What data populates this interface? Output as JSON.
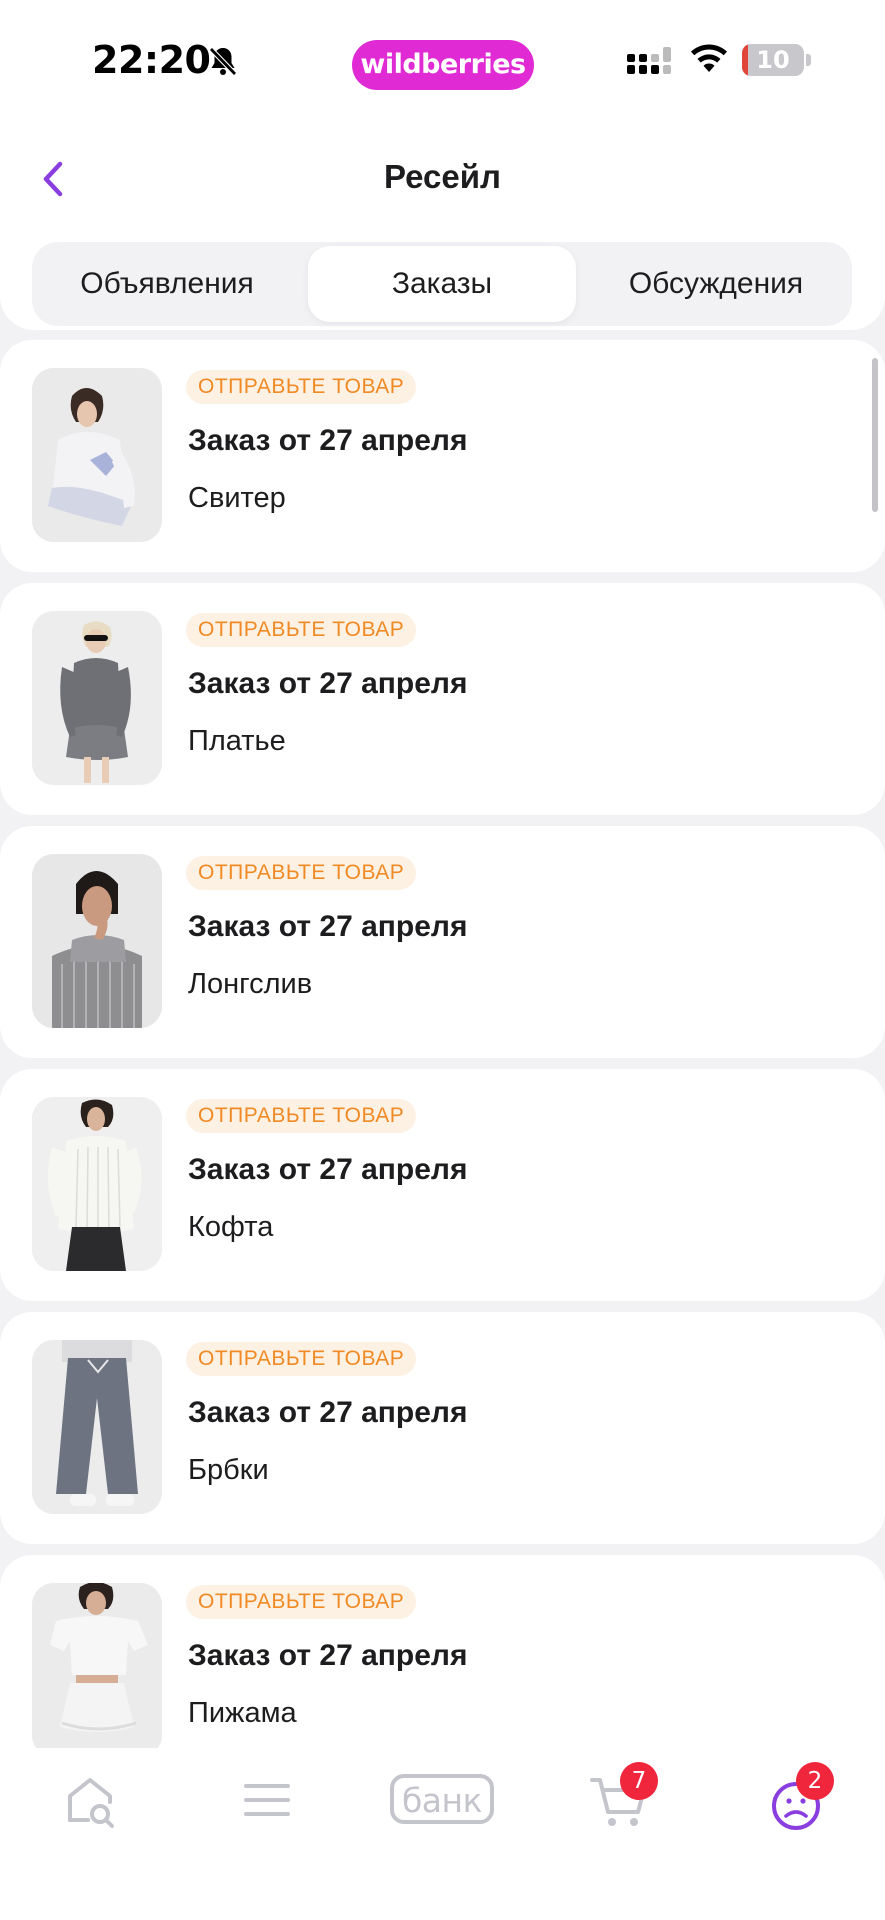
{
  "status_bar": {
    "time": "22:20",
    "brand_pill": "wildberries",
    "battery_level": "10",
    "battery_fraction": 0.1,
    "icons": [
      "bell-slash-icon",
      "cellular-signal-icon",
      "wifi-icon",
      "battery-icon"
    ]
  },
  "header": {
    "title": "Ресейл",
    "back_icon": "chevron-left-icon"
  },
  "tabs": [
    {
      "label": "Объявления",
      "active": false
    },
    {
      "label": "Заказы",
      "active": true
    },
    {
      "label": "Обсуждения",
      "active": false
    }
  ],
  "orders": [
    {
      "status": "ОТПРАВЬТЕ ТОВАР",
      "title": "Заказ от 27 апреля",
      "item": "Свитер"
    },
    {
      "status": "ОТПРАВЬТЕ ТОВАР",
      "title": "Заказ от 27 апреля",
      "item": "Платье"
    },
    {
      "status": "ОТПРАВЬТЕ ТОВАР",
      "title": "Заказ от 27 апреля",
      "item": "Лонгслив"
    },
    {
      "status": "ОТПРАВЬТЕ ТОВАР",
      "title": "Заказ от 27 апреля",
      "item": "Кофта"
    },
    {
      "status": "ОТПРАВЬТЕ ТОВАР",
      "title": "Заказ от 27 апреля",
      "item": "Брбки"
    },
    {
      "status": "ОТПРАВЬТЕ ТОВАР",
      "title": "Заказ от 27 апреля",
      "item": "Пижама"
    }
  ],
  "bottom_nav": {
    "items": [
      {
        "icon": "home-search-icon",
        "label": ""
      },
      {
        "icon": "menu-icon",
        "label": ""
      },
      {
        "icon": "bank-icon",
        "label": "банк"
      },
      {
        "icon": "cart-icon",
        "badge": "7"
      },
      {
        "icon": "profile-icon",
        "badge": "2"
      }
    ]
  },
  "colors": {
    "accent": "#8a3ee0",
    "brand_pink": "#e02bd5",
    "status_orange": "#f08a24",
    "badge_red": "#f0263c"
  }
}
